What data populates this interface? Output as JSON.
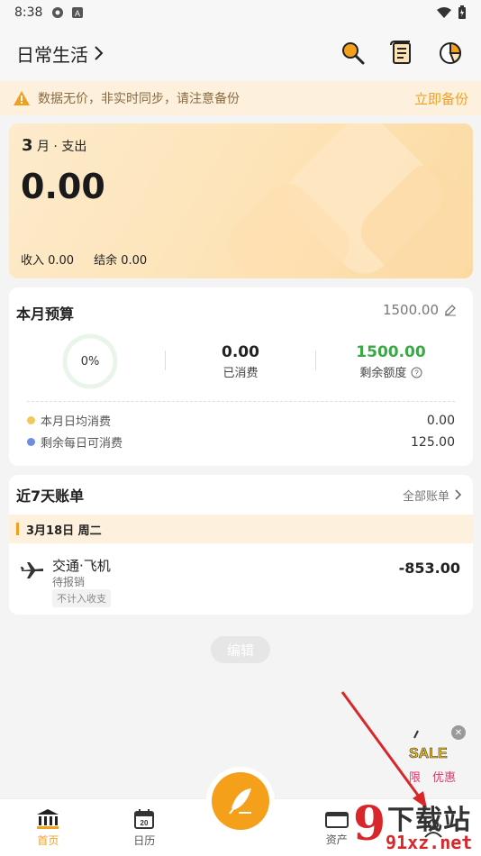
{
  "status_bar": {
    "time": "8:38"
  },
  "header": {
    "title": "日常生活"
  },
  "warning": {
    "message": "数据无价，非实时同步，请注意备份",
    "action": "立即备份"
  },
  "expense": {
    "month_num": "3",
    "month_suffix": "月 · 支出",
    "amount": "0.00",
    "income_label": "收入 0.00",
    "balance_label": "结余 0.00"
  },
  "budget": {
    "title": "本月预算",
    "total": "1500.00",
    "percent": "0%",
    "spent_value": "0.00",
    "spent_label": "已消费",
    "remaining_value": "1500.00",
    "remaining_label": "剩余额度",
    "daily_avg_label": "本月日均消费",
    "daily_avg_value": "0.00",
    "daily_left_label": "剩余每日可消费",
    "daily_left_value": "125.00"
  },
  "bills": {
    "title": "近7天账单",
    "all_link": "全部账单",
    "date": "3月18日 周二",
    "items": [
      {
        "name": "交通·飞机",
        "status": "待报销",
        "tag": "不计入收支",
        "amount": "-853.00"
      }
    ]
  },
  "edit_label": "编辑",
  "promo": {
    "sale": "SALE",
    "text_left": "限",
    "text_right": "优惠"
  },
  "tabs": [
    {
      "label": "首页",
      "calendar_day": "20"
    },
    {
      "label": "日历"
    },
    {
      "label": "资产"
    }
  ],
  "watermark": {
    "big": "下载站",
    "small": "91xz.net",
    "nine": "9"
  },
  "colors": {
    "accent": "#f0a020",
    "remaining": "#3aa844",
    "warning_bg": "#fdf1de"
  }
}
